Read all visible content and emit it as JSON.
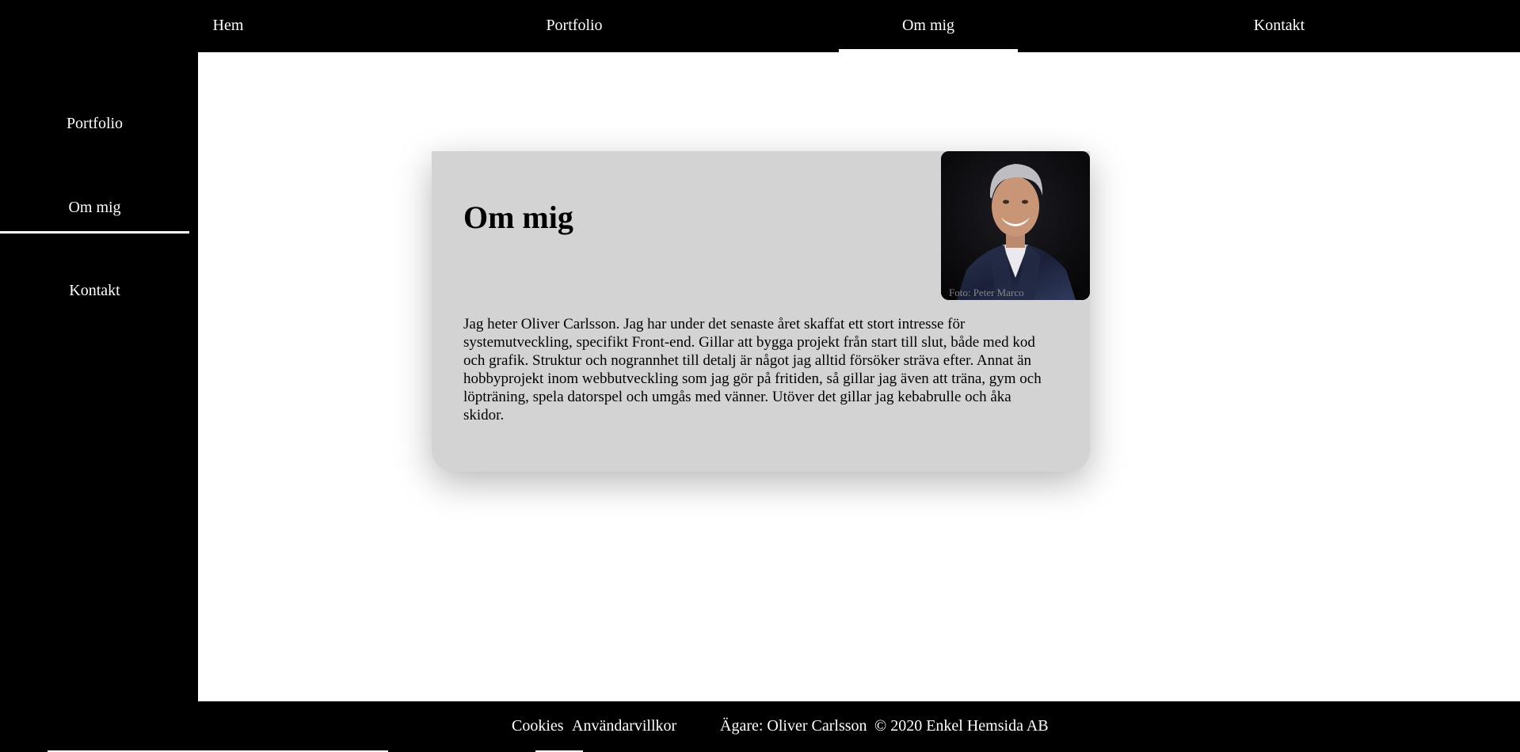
{
  "top_nav": {
    "items": [
      {
        "label": "Hem"
      },
      {
        "label": "Portfolio"
      },
      {
        "label": "Om mig"
      },
      {
        "label": "Kontakt"
      }
    ],
    "active": "Om mig"
  },
  "sidebar": {
    "items": [
      {
        "label": "Portfolio"
      },
      {
        "label": "Om mig"
      },
      {
        "label": "Kontakt"
      }
    ],
    "active": "Om mig"
  },
  "card": {
    "title": "Om mig",
    "body": "Jag heter Oliver Carlsson. Jag har under det senaste året skaffat ett stort intresse för systemutveckling, specifikt Front-end. Gillar att bygga projekt från start till slut, både med kod och grafik. Struktur och nogrannhet till detalj är något jag alltid försöker sträva efter. Annat än hobbyprojekt inom webbutveckling som jag gör på fritiden, så gillar jag även att träna, gym och löpträning, spela datorspel och umgås med vänner. Utöver det gillar jag kebabrulle och åka skidor.",
    "photo_credit": "Foto: Peter Marco"
  },
  "footer": {
    "cookies": "Cookies",
    "terms": "Användarvillkor",
    "owner": "Ägare: Oliver Carlsson",
    "copyright": "© 2020 Enkel Hemsida AB"
  },
  "colors": {
    "nav_background": "#000000",
    "main_background": "#ffffff",
    "card_background": "#d3d3d3",
    "text_light": "#ffffff",
    "text_dark": "#000000"
  }
}
